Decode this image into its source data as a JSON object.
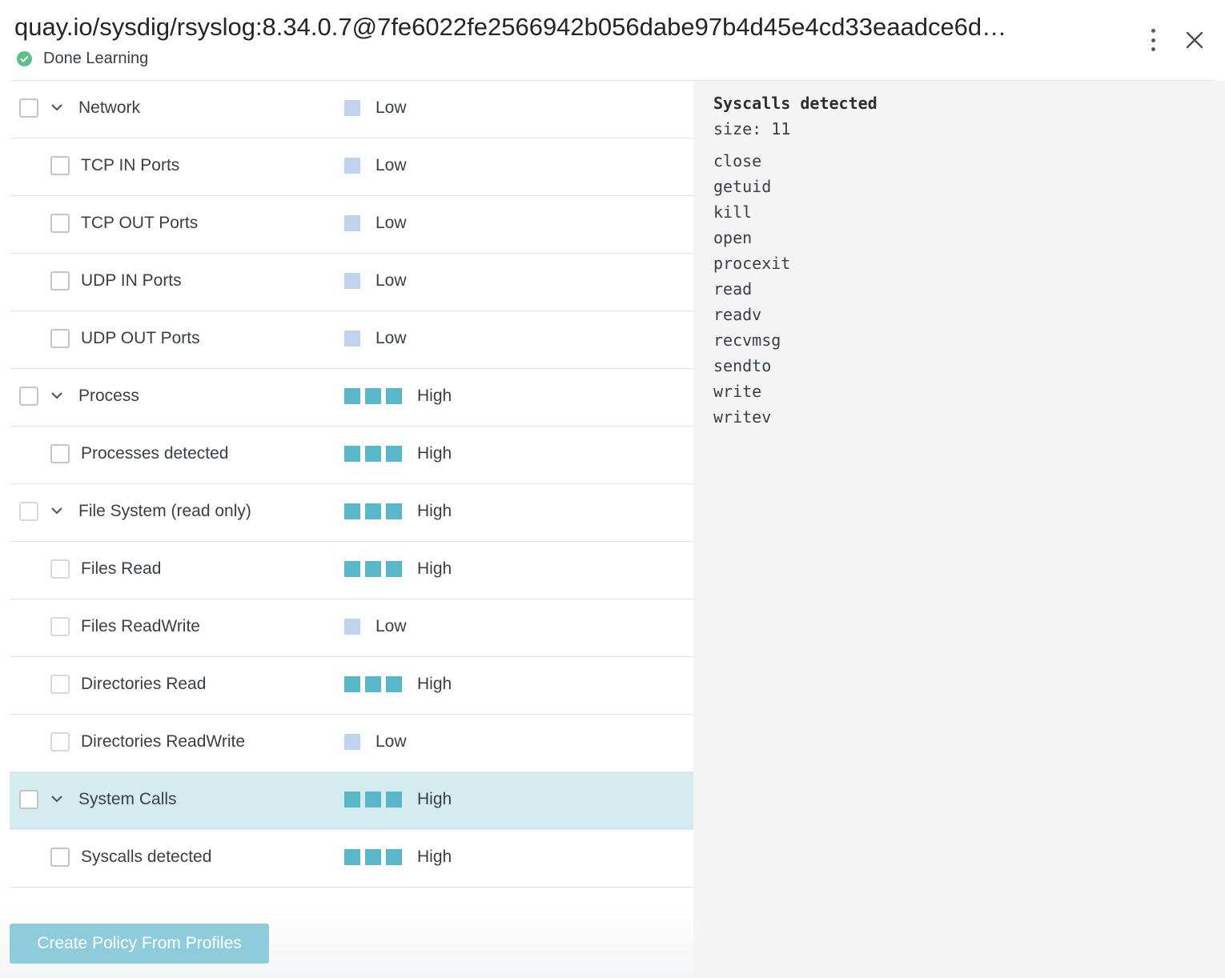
{
  "header": {
    "title": "quay.io/sysdig/rsyslog:8.34.0.7@7fe6022fe2566942b056dabe97b4d45e4cd33eaadce6d…",
    "status_label": "Done Learning"
  },
  "colors": {
    "low": "#bfd3ee",
    "high": "#5ab6c9",
    "selected_row": "#d4ecf0",
    "status_ok": "#5cc08a",
    "button": "#8ecbdb"
  },
  "profile_rows": [
    {
      "label": "Network",
      "level": "Low",
      "level_value": 1,
      "is_group": true,
      "selected": false
    },
    {
      "label": "TCP IN Ports",
      "level": "Low",
      "level_value": 1,
      "is_group": false,
      "selected": false
    },
    {
      "label": "TCP OUT Ports",
      "level": "Low",
      "level_value": 1,
      "is_group": false,
      "selected": false
    },
    {
      "label": "UDP IN Ports",
      "level": "Low",
      "level_value": 1,
      "is_group": false,
      "selected": false
    },
    {
      "label": "UDP OUT Ports",
      "level": "Low",
      "level_value": 1,
      "is_group": false,
      "selected": false
    },
    {
      "label": "Process",
      "level": "High",
      "level_value": 3,
      "is_group": true,
      "selected": false
    },
    {
      "label": "Processes detected",
      "level": "High",
      "level_value": 3,
      "is_group": false,
      "selected": false
    },
    {
      "label": "File System (read only)",
      "level": "High",
      "level_value": 3,
      "is_group": true,
      "selected": false
    },
    {
      "label": "Files Read",
      "level": "High",
      "level_value": 3,
      "is_group": false,
      "selected": false
    },
    {
      "label": "Files ReadWrite",
      "level": "Low",
      "level_value": 1,
      "is_group": false,
      "selected": false
    },
    {
      "label": "Directories Read",
      "level": "High",
      "level_value": 3,
      "is_group": false,
      "selected": false
    },
    {
      "label": "Directories ReadWrite",
      "level": "Low",
      "level_value": 1,
      "is_group": false,
      "selected": false
    },
    {
      "label": "System Calls",
      "level": "High",
      "level_value": 3,
      "is_group": true,
      "selected": true
    },
    {
      "label": "Syscalls detected",
      "level": "High",
      "level_value": 3,
      "is_group": false,
      "selected": false
    }
  ],
  "footer": {
    "create_button_label": "Create Policy From Profiles"
  },
  "detail": {
    "title": "Syscalls detected",
    "size_text": "size: 11",
    "items": [
      "close",
      "getuid",
      "kill",
      "open",
      "procexit",
      "read",
      "readv",
      "recvmsg",
      "sendto",
      "write",
      "writev"
    ]
  }
}
